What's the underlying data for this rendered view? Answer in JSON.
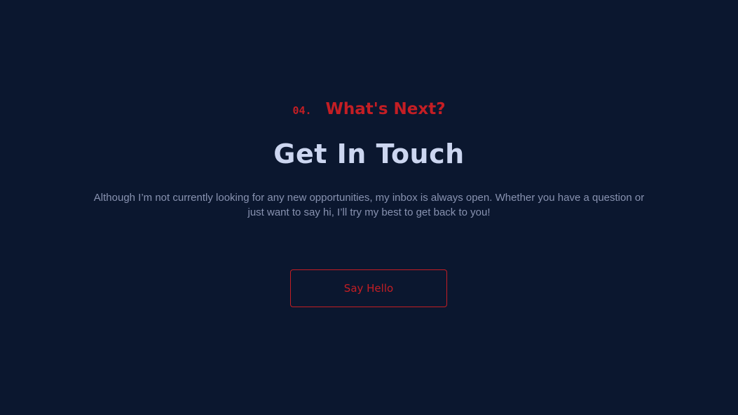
{
  "contact": {
    "section_number": "04.",
    "overline": "What's Next?",
    "title": "Get In Touch",
    "description": "Although I’m not currently looking for any new opportunities, my inbox is always open. Whether you have a question or just want to say hi, I’ll try my best to get back to you!",
    "button_label": "Say Hello"
  },
  "colors": {
    "background": "#0b172f",
    "accent": "#c41e24",
    "heading": "#ccd6f0",
    "body_text": "#8892b0"
  }
}
